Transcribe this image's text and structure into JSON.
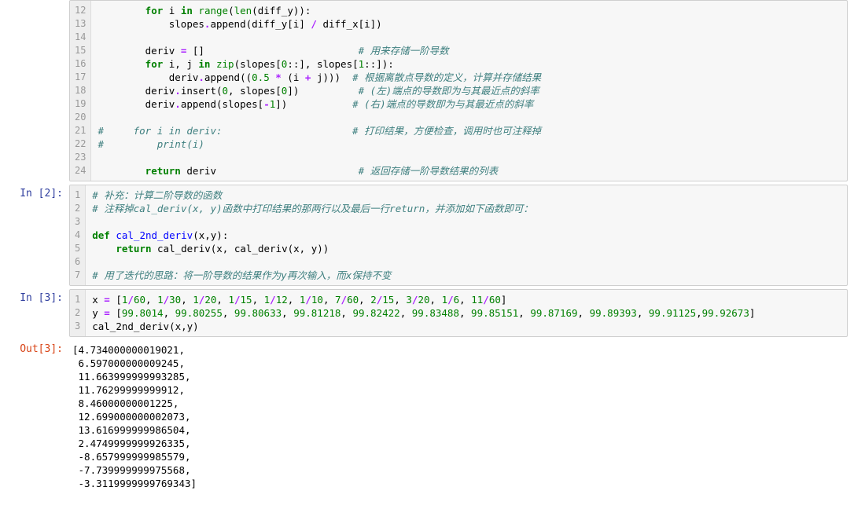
{
  "cells": [
    {
      "type": "code",
      "prompt": "",
      "gutter_start": 12,
      "code_html": "        <span class='kw'>for</span> i <span class='kw'>in</span> <span class='bi'>range</span>(<span class='bi'>len</span>(diff_y)):\n            slopes<span class='op'>.</span>append(diff_y[i] <span class='op'>/</span> diff_x[i])\n\n        deriv <span class='op'>=</span> []                          <span class='cm'># 用来存储一阶导数</span>\n        <span class='kw'>for</span> i, j <span class='kw'>in</span> <span class='bi'>zip</span>(slopes[<span class='num'>0</span>::], slopes[<span class='num'>1</span>::]):\n            deriv<span class='op'>.</span>append((<span class='num'>0.5</span> <span class='op'>*</span> (i <span class='op'>+</span> j)))  <span class='cm'># 根据离散点导数的定义，计算并存储结果</span>\n        deriv<span class='op'>.</span>insert(<span class='num'>0</span>, slopes[<span class='num'>0</span>])          <span class='cm'># (左)端点的导数即为与其最近点的斜率</span>\n        deriv<span class='op'>.</span>append(slopes[<span class='op'>-</span><span class='num'>1</span>])           <span class='cm'># (右)端点的导数即为与其最近点的斜率</span>\n\n<span class='cm'>#     for i in deriv:                      # 打印结果，方便检查，调用时也可注释掉</span>\n<span class='cm'>#         print(i)</span>\n\n        <span class='kw'>return</span> deriv                        <span class='cm'># 返回存储一阶导数结果的列表</span>"
    },
    {
      "type": "code",
      "prompt": "In [2]:",
      "gutter_start": 1,
      "code_html": "<span class='cm'># 补充：计算二阶导数的函数</span>\n<span class='cm'># 注释掉cal_deriv(x, y)函数中打印结果的那两行以及最后一行return，并添加如下函数即可：</span>\n\n<span class='kw'>def</span> <span class='nm' style='color:#0000FF'>cal_2nd_deriv</span>(x,y):\n    <span class='kw'>return</span> cal_deriv(x, cal_deriv(x, y))\n\n<span class='cm'># 用了迭代的思路：将一阶导数的结果作为y再次输入，而x保持不变</span>"
    },
    {
      "type": "code",
      "prompt": "In [3]:",
      "gutter_start": 1,
      "code_html": "x <span class='op'>=</span> [<span class='num'>1</span><span class='op'>/</span><span class='num'>60</span>, <span class='num'>1</span><span class='op'>/</span><span class='num'>30</span>, <span class='num'>1</span><span class='op'>/</span><span class='num'>20</span>, <span class='num'>1</span><span class='op'>/</span><span class='num'>15</span>, <span class='num'>1</span><span class='op'>/</span><span class='num'>12</span>, <span class='num'>1</span><span class='op'>/</span><span class='num'>10</span>, <span class='num'>7</span><span class='op'>/</span><span class='num'>60</span>, <span class='num'>2</span><span class='op'>/</span><span class='num'>15</span>, <span class='num'>3</span><span class='op'>/</span><span class='num'>20</span>, <span class='num'>1</span><span class='op'>/</span><span class='num'>6</span>, <span class='num'>11</span><span class='op'>/</span><span class='num'>60</span>]\ny <span class='op'>=</span> [<span class='num'>99.8014</span>, <span class='num'>99.80255</span>, <span class='num'>99.80633</span>, <span class='num'>99.81218</span>, <span class='num'>99.82422</span>, <span class='num'>99.83488</span>, <span class='num'>99.85151</span>, <span class='num'>99.87169</span>, <span class='num'>99.89393</span>, <span class='num'>99.91125</span>,<span class='num'>99.92673</span>]\ncal_2nd_deriv(x,y)"
    },
    {
      "type": "output",
      "prompt": "Out[3]:",
      "text": "[4.734000000019021,\n 6.597000000009245,\n 11.663999999993285,\n 11.76299999999912,\n 8.46000000001225,\n 12.699000000002073,\n 13.616999999986504,\n 2.4749999999926335,\n -8.657999999985579,\n -7.739999999975568,\n -3.3119999999769343]"
    }
  ]
}
